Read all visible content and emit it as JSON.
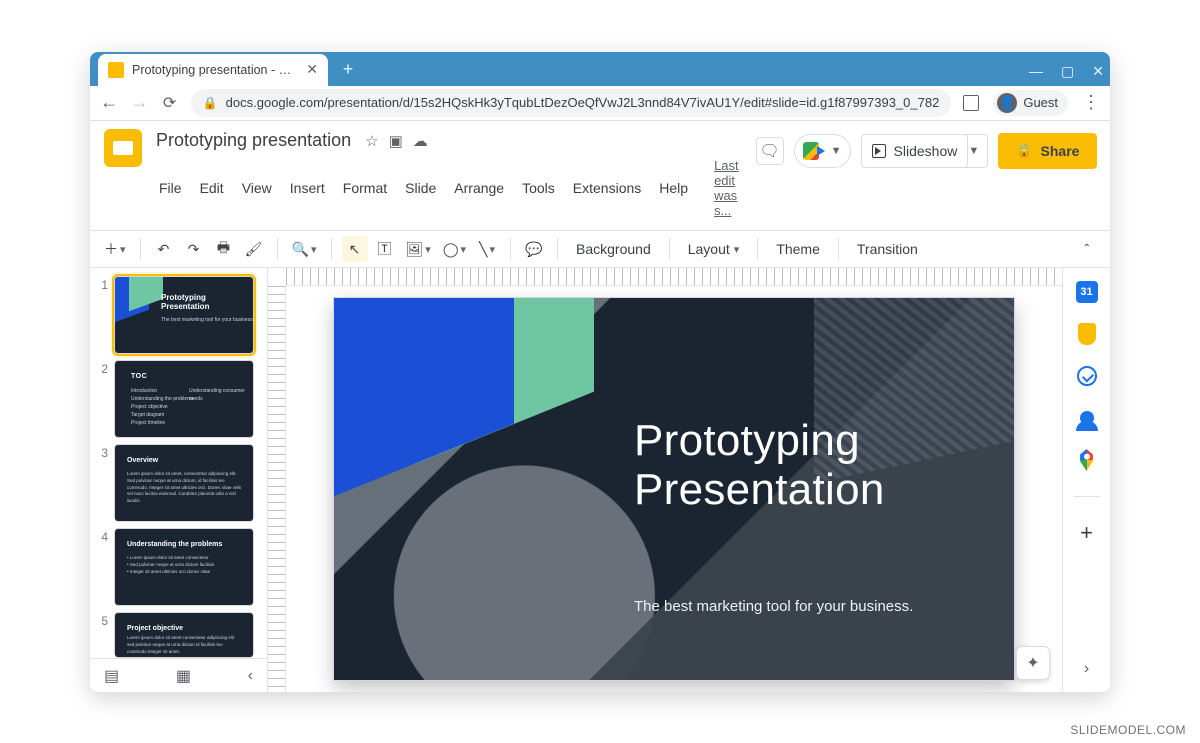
{
  "browser": {
    "tab_title": "Prototyping presentation - Goog",
    "url": "docs.google.com/presentation/d/15s2HQskHk3yTqubLtDezOeQfVwJ2L3nnd84V7ivAU1Y/edit#slide=id.g1f87997393_0_782",
    "guest_label": "Guest",
    "window_controls": {
      "minimize": "—",
      "maximize": "▢",
      "close": "✕"
    }
  },
  "app": {
    "doc_title": "Prototyping presentation",
    "menus": [
      "File",
      "Edit",
      "View",
      "Insert",
      "Format",
      "Slide",
      "Arrange",
      "Tools",
      "Extensions",
      "Help"
    ],
    "last_edit": "Last edit was s...",
    "buttons": {
      "slideshow": "Slideshow",
      "share": "Share"
    },
    "toolbar": {
      "background": "Background",
      "layout": "Layout",
      "theme": "Theme",
      "transition": "Transition"
    }
  },
  "thumbs": [
    {
      "n": "1",
      "title": "Prototyping\nPresentation",
      "subtitle": "The best marketing tool for your business"
    },
    {
      "n": "2",
      "heading": "TOC",
      "col1": [
        "Introduction",
        "Understanding the problems",
        "Project objective",
        "Target diagram",
        "Project timeline"
      ],
      "col2": [
        "Understanding consumer needs",
        "",
        "",
        "",
        ""
      ]
    },
    {
      "n": "3",
      "heading": "Overview",
      "body": "Lorem ipsum dolor sit amet, consectetur adipiscing elit. Sed pulvinar neque at urna dictum, id facilisis leo commodo. Integer sit amet ultricies orci. Donec vitae velit vel nunc lacinia euismod. Curabitur placerat odio a nisl iaculis."
    },
    {
      "n": "4",
      "heading": "Understanding the problems",
      "bullets": [
        "Lorem ipsum dolor sit amet consectetur",
        "Sed pulvinar neque at urna dictum facilisis",
        "Integer sit amet ultricies orci donec vitae"
      ]
    },
    {
      "n": "5",
      "heading": "Project objective",
      "body": "Lorem ipsum dolor sit amet consectetur adipiscing elit sed pulvinar neque at urna dictum id facilisis leo commodo integer sit amet."
    }
  ],
  "slide": {
    "title": "Prototyping\nPresentation",
    "tagline": "The best marketing tool for your business."
  },
  "side_rail": {
    "calendar_day": "31"
  },
  "watermark": "SLIDEMODEL.COM",
  "colors": {
    "accent_yellow": "#fbbc04",
    "strip_blue": "#1a4fd6",
    "strip_teal": "#6ec6a3",
    "slide_bg": "#1b2431",
    "chrome_blue": "#3f8fc4"
  }
}
